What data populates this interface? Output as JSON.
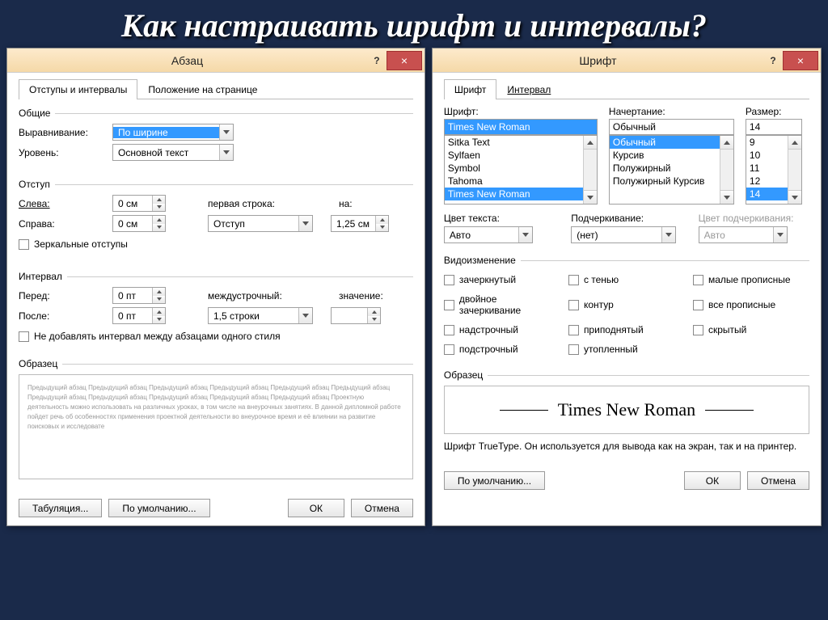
{
  "slide_title": "Как настраивать шрифт и интервалы?",
  "paragraph": {
    "title": "Абзац",
    "help": "?",
    "close": "×",
    "tabs": {
      "active": "Отступы и интервалы",
      "other": "Положение на странице"
    },
    "sections": {
      "general": "Общие",
      "indent": "Отступ",
      "interval": "Интервал",
      "sample": "Образец"
    },
    "alignment": {
      "label": "Выравнивание:",
      "value": "По ширине"
    },
    "level": {
      "label": "Уровень:",
      "value": "Основной текст"
    },
    "left": {
      "label": "Слева:",
      "value": "0 см"
    },
    "right": {
      "label": "Справа:",
      "value": "0 см"
    },
    "first_line": {
      "label": "первая строка:",
      "value": "Отступ"
    },
    "by": {
      "label": "на:",
      "value": "1,25 см"
    },
    "mirror": "Зеркальные отступы",
    "before": {
      "label": "Перед:",
      "value": "0 пт"
    },
    "after": {
      "label": "После:",
      "value": "0 пт"
    },
    "line_spacing": {
      "label": "междустрочный:",
      "value": "1,5 строки"
    },
    "line_value_label": "значение:",
    "no_space": "Не добавлять интервал между абзацами одного стиля",
    "preview": "Предыдущий абзац Предыдущий абзац Предыдущий абзац Предыдущий абзац Предыдущий абзац Предыдущий абзац Предыдущий абзац Предыдущий абзац Предыдущий абзац Предыдущий абзац Предыдущий абзац\n\n    Проектную деятельность можно использовать на различных уроках, в том числе на внеурочных занятиях. В данной дипломной работе пойдет речь об особенностях применения проектной деятельности во внеурочное время и её влиянии на развитие поисковых и исследовате",
    "buttons": {
      "tabs": "Табуляция...",
      "default": "По умолчанию...",
      "ok": "ОК",
      "cancel": "Отмена"
    }
  },
  "font": {
    "title": "Шрифт",
    "help": "?",
    "close": "×",
    "tabs": {
      "active": "Шрифт",
      "other": "Интервал"
    },
    "font_label": "Шрифт:",
    "font_value": "Times New Roman",
    "font_list": [
      "Sitka Text",
      "Sylfaen",
      "Symbol",
      "Tahoma",
      "Times New Roman"
    ],
    "style_label": "Начертание:",
    "style_value": "Обычный",
    "style_list": [
      "Обычный",
      "Курсив",
      "Полужирный",
      "Полужирный Курсив"
    ],
    "size_label": "Размер:",
    "size_value": "14",
    "size_list": [
      "9",
      "10",
      "11",
      "12",
      "14"
    ],
    "color_label": "Цвет текста:",
    "color_value": "Авто",
    "underline_label": "Подчеркивание:",
    "underline_value": "(нет)",
    "ucolor_label": "Цвет подчеркивания:",
    "ucolor_value": "Авто",
    "effects_label": "Видоизменение",
    "effects": {
      "c11": "зачеркнутый",
      "c12": "с тенью",
      "c13": "малые прописные",
      "c21": "двойное зачеркивание",
      "c22": "контур",
      "c23": "все прописные",
      "c31": "надстрочный",
      "c32": "приподнятый",
      "c33": "скрытый",
      "c41": "подстрочный",
      "c42": "утопленный"
    },
    "sample_label": "Образец",
    "sample_text": "Times New Roman",
    "note": "Шрифт TrueType. Он используется для вывода как на экран, так и на принтер.",
    "buttons": {
      "default": "По умолчанию...",
      "ok": "ОК",
      "cancel": "Отмена"
    }
  }
}
